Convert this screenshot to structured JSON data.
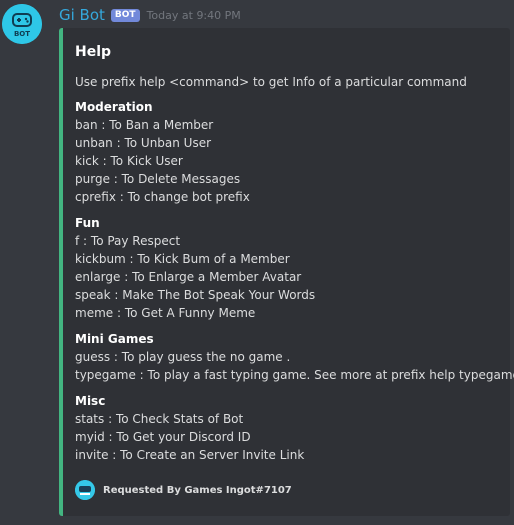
{
  "message": {
    "author": "Gi Bot",
    "tag": "BOT",
    "timestamp": "Today at 9:40 PM",
    "avatar_label": "BOT"
  },
  "embed": {
    "accent_color": "#43b581",
    "title": "Help",
    "description": "Use prefix help <command> to get Info of a particular command",
    "sections": [
      {
        "title": "Moderation",
        "lines": [
          "ban : To Ban a Member",
          "unban : To Unban User",
          "kick : To Kick User",
          "purge : To Delete Messages",
          "cprefix : To change bot prefix"
        ]
      },
      {
        "title": "Fun",
        "lines": [
          "f : To Pay Respect",
          "kickbum : To Kick Bum of a Member",
          "enlarge : To Enlarge a Member Avatar",
          "speak : Make The Bot Speak Your Words",
          "meme : To Get A Funny Meme"
        ]
      },
      {
        "title": "Mini Games",
        "lines": [
          "guess : To play guess the no game .",
          "typegame : To play a fast typing game. See more at prefix help typegame"
        ]
      },
      {
        "title": "Misc",
        "lines": [
          "stats : To Check Stats of Bot",
          "myid : To Get your Discord ID",
          "invite : To Create an Server Invite Link"
        ]
      }
    ],
    "footer": "Requested By Games Ingot#7107"
  },
  "colors": {
    "background": "#36393f",
    "embed_background": "#2f3136",
    "username": "#35a8dc",
    "bot_tag": "#7289da",
    "avatar": "#2ec7e7"
  },
  "icons": {
    "avatar": "gamepad-bot-avatar-icon",
    "footer": "games-ingot-avatar-icon"
  }
}
